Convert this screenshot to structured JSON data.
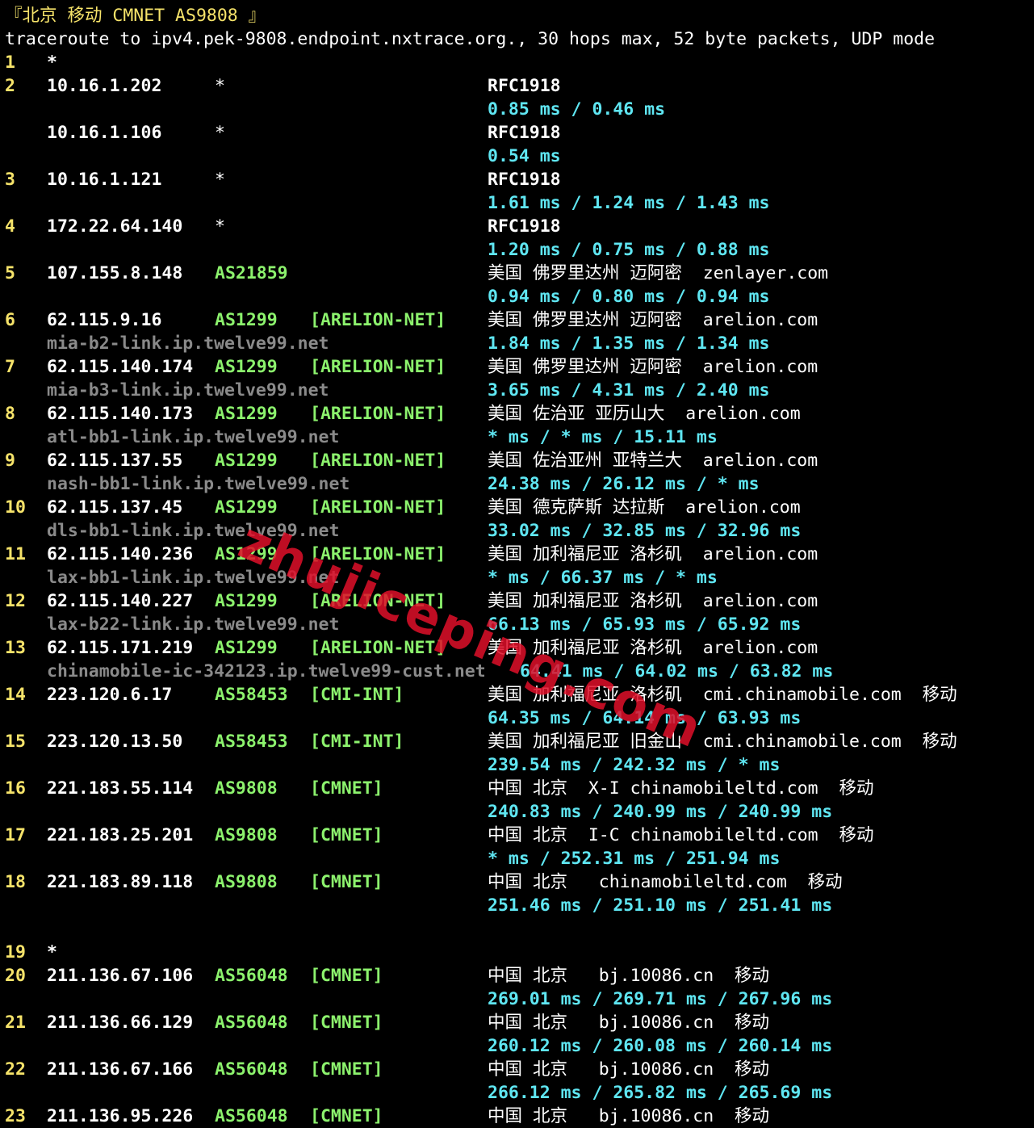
{
  "header": "『北京 移动 CMNET AS9808 』",
  "command": "traceroute to ipv4.pek-9808.endpoint.nxtrace.org., 30 hops max, 52 byte packets, UDP mode",
  "watermark": "zhujiceping.com",
  "colors": {
    "background": "#000000",
    "hop_number": "#f6e36a",
    "asn": "#8cf26d",
    "rtt": "#5fe6f2",
    "hostname": "#8a8a8a",
    "watermark": "#e0102a"
  },
  "rows": [
    {
      "type": "hop",
      "num": "1",
      "ip": "*"
    },
    {
      "type": "hop",
      "num": "2",
      "ip": "10.16.1.202",
      "as": "*",
      "info": "RFC1918"
    },
    {
      "type": "rtt",
      "rtt": "0.85 ms / 0.46 ms"
    },
    {
      "type": "hop",
      "num": "",
      "ip": "10.16.1.106",
      "as": "*",
      "info": "RFC1918"
    },
    {
      "type": "rtt",
      "rtt": "0.54 ms"
    },
    {
      "type": "hop",
      "num": "3",
      "ip": "10.16.1.121",
      "as": "*",
      "info": "RFC1918"
    },
    {
      "type": "rtt",
      "rtt": "1.61 ms / 1.24 ms / 1.43 ms"
    },
    {
      "type": "hop",
      "num": "4",
      "ip": "172.22.64.140",
      "as": "*",
      "info": "RFC1918"
    },
    {
      "type": "rtt",
      "rtt": "1.20 ms / 0.75 ms / 0.88 ms"
    },
    {
      "type": "hop",
      "num": "5",
      "ip": "107.155.8.148",
      "as": "AS21859",
      "geo": "美国 佛罗里达州 迈阿密  zenlayer.com"
    },
    {
      "type": "rtt",
      "rtt": "0.94 ms / 0.80 ms / 0.94 ms"
    },
    {
      "type": "hop",
      "num": "6",
      "ip": "62.115.9.16",
      "as": "AS1299",
      "net": "[ARELION-NET]",
      "geo": "美国 佛罗里达州 迈阿密  arelion.com"
    },
    {
      "type": "rtt",
      "host": "mia-b2-link.ip.twelve99.net",
      "rtt": "1.84 ms / 1.35 ms / 1.34 ms"
    },
    {
      "type": "hop",
      "num": "7",
      "ip": "62.115.140.174",
      "as": "AS1299",
      "net": "[ARELION-NET]",
      "geo": "美国 佛罗里达州 迈阿密  arelion.com"
    },
    {
      "type": "rtt",
      "host": "mia-b3-link.ip.twelve99.net",
      "rtt": "3.65 ms / 4.31 ms / 2.40 ms"
    },
    {
      "type": "hop",
      "num": "8",
      "ip": "62.115.140.173",
      "as": "AS1299",
      "net": "[ARELION-NET]",
      "geo": "美国 佐治亚 亚历山大  arelion.com"
    },
    {
      "type": "rtt",
      "host": "atl-bb1-link.ip.twelve99.net",
      "rtt": "* ms / * ms / 15.11 ms"
    },
    {
      "type": "hop",
      "num": "9",
      "ip": "62.115.137.55",
      "as": "AS1299",
      "net": "[ARELION-NET]",
      "geo": "美国 佐治亚州 亚特兰大  arelion.com"
    },
    {
      "type": "rtt",
      "host": "nash-bb1-link.ip.twelve99.net",
      "rtt": "24.38 ms / 26.12 ms / * ms"
    },
    {
      "type": "hop",
      "num": "10",
      "ip": "62.115.137.45",
      "as": "AS1299",
      "net": "[ARELION-NET]",
      "geo": "美国 德克萨斯 达拉斯  arelion.com"
    },
    {
      "type": "rtt",
      "host": "dls-bb1-link.ip.twelve99.net",
      "rtt": "33.02 ms / 32.85 ms / 32.96 ms"
    },
    {
      "type": "hop",
      "num": "11",
      "ip": "62.115.140.236",
      "as": "AS1299",
      "net": "[ARELION-NET]",
      "geo": "美国 加利福尼亚 洛杉矶  arelion.com"
    },
    {
      "type": "rtt",
      "host": "lax-bb1-link.ip.twelve99.net",
      "rtt": "* ms / 66.37 ms / * ms"
    },
    {
      "type": "hop",
      "num": "12",
      "ip": "62.115.140.227",
      "as": "AS1299",
      "net": "[ARELION-NET]",
      "geo": "美国 加利福尼亚 洛杉矶  arelion.com"
    },
    {
      "type": "rtt",
      "host": "lax-b22-link.ip.twelve99.net",
      "rtt": "66.13 ms / 65.93 ms / 65.92 ms"
    },
    {
      "type": "hop",
      "num": "13",
      "ip": "62.115.171.219",
      "as": "AS1299",
      "net": "[ARELION-NET]",
      "geo": "美国 加利福尼亚 洛杉矶  arelion.com"
    },
    {
      "type": "rtt",
      "host": "chinamobile-ic-342123.ip.twelve99-cust.net",
      "rtt": "64.41 ms / 64.02 ms / 63.82 ms",
      "shift": true
    },
    {
      "type": "hop",
      "num": "14",
      "ip": "223.120.6.17",
      "as": "AS58453",
      "net": "[CMI-INT]",
      "geo": "美国 加利福尼亚 洛杉矶  cmi.chinamobile.com  移动"
    },
    {
      "type": "rtt",
      "rtt": "64.35 ms / 64.14 ms / 63.93 ms"
    },
    {
      "type": "hop",
      "num": "15",
      "ip": "223.120.13.50",
      "as": "AS58453",
      "net": "[CMI-INT]",
      "geo": "美国 加利福尼亚 旧金山  cmi.chinamobile.com  移动"
    },
    {
      "type": "rtt",
      "rtt": "239.54 ms / 242.32 ms / * ms"
    },
    {
      "type": "hop",
      "num": "16",
      "ip": "221.183.55.114",
      "as": "AS9808",
      "net": "[CMNET]",
      "geo": "中国 北京  X-I chinamobileltd.com  移动"
    },
    {
      "type": "rtt",
      "rtt": "240.83 ms / 240.99 ms / 240.99 ms"
    },
    {
      "type": "hop",
      "num": "17",
      "ip": "221.183.25.201",
      "as": "AS9808",
      "net": "[CMNET]",
      "geo": "中国 北京  I-C chinamobileltd.com  移动"
    },
    {
      "type": "rtt",
      "rtt": "* ms / 252.31 ms / 251.94 ms"
    },
    {
      "type": "hop",
      "num": "18",
      "ip": "221.183.89.118",
      "as": "AS9808",
      "net": "[CMNET]",
      "geo": "中国 北京   chinamobileltd.com  移动"
    },
    {
      "type": "rtt",
      "rtt": "251.46 ms / 251.10 ms / 251.41 ms"
    },
    {
      "type": "hop",
      "num": "19",
      "ip": "*"
    },
    {
      "type": "hop",
      "num": "20",
      "ip": "211.136.67.106",
      "as": "AS56048",
      "net": "[CMNET]",
      "geo": "中国 北京   bj.10086.cn  移动"
    },
    {
      "type": "rtt",
      "rtt": "269.01 ms / 269.71 ms / 267.96 ms"
    },
    {
      "type": "hop",
      "num": "21",
      "ip": "211.136.66.129",
      "as": "AS56048",
      "net": "[CMNET]",
      "geo": "中国 北京   bj.10086.cn  移动"
    },
    {
      "type": "rtt",
      "rtt": "260.12 ms / 260.08 ms / 260.14 ms"
    },
    {
      "type": "hop",
      "num": "22",
      "ip": "211.136.67.166",
      "as": "AS56048",
      "net": "[CMNET]",
      "geo": "中国 北京   bj.10086.cn  移动"
    },
    {
      "type": "rtt",
      "rtt": "266.12 ms / 265.82 ms / 265.69 ms"
    },
    {
      "type": "hop",
      "num": "23",
      "ip": "211.136.95.226",
      "as": "AS56048",
      "net": "[CMNET]",
      "geo": "中国 北京   bj.10086.cn  移动"
    }
  ]
}
